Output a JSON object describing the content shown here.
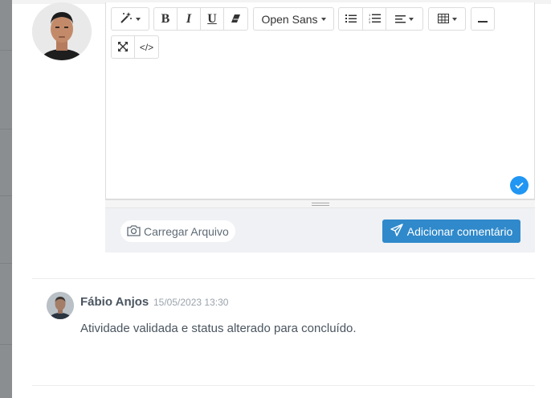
{
  "editor": {
    "toolbar": {
      "style_icon": "magic-wand-icon",
      "bold_label": "B",
      "italic_label": "I",
      "underline_label": "U",
      "eraser_icon": "eraser-icon",
      "font_family_selected": "Open Sans",
      "ul_icon": "unordered-list-icon",
      "ol_icon": "ordered-list-icon",
      "align_icon": "align-icon",
      "table_icon": "table-icon",
      "hr_icon": "horizontal-rule-icon",
      "fullscreen_icon": "fullscreen-icon",
      "codeview_label": "</>"
    },
    "content": "",
    "status_icon": "check-circle-icon"
  },
  "footer": {
    "upload_label": "Carregar Arquivo",
    "upload_icon": "camera-icon",
    "submit_label": "Adicionar comentário",
    "submit_icon": "send-icon"
  },
  "comments": [
    {
      "author": "Fábio Anjos",
      "date": "15/05/2023 13:30",
      "text": "Atividade validada e status alterado para concluído."
    }
  ],
  "colors": {
    "accent": "#2f89cb",
    "check": "#2196f3",
    "footer_bg": "#eff1f4",
    "text": "#4a5560",
    "muted": "#9aa3ab"
  }
}
